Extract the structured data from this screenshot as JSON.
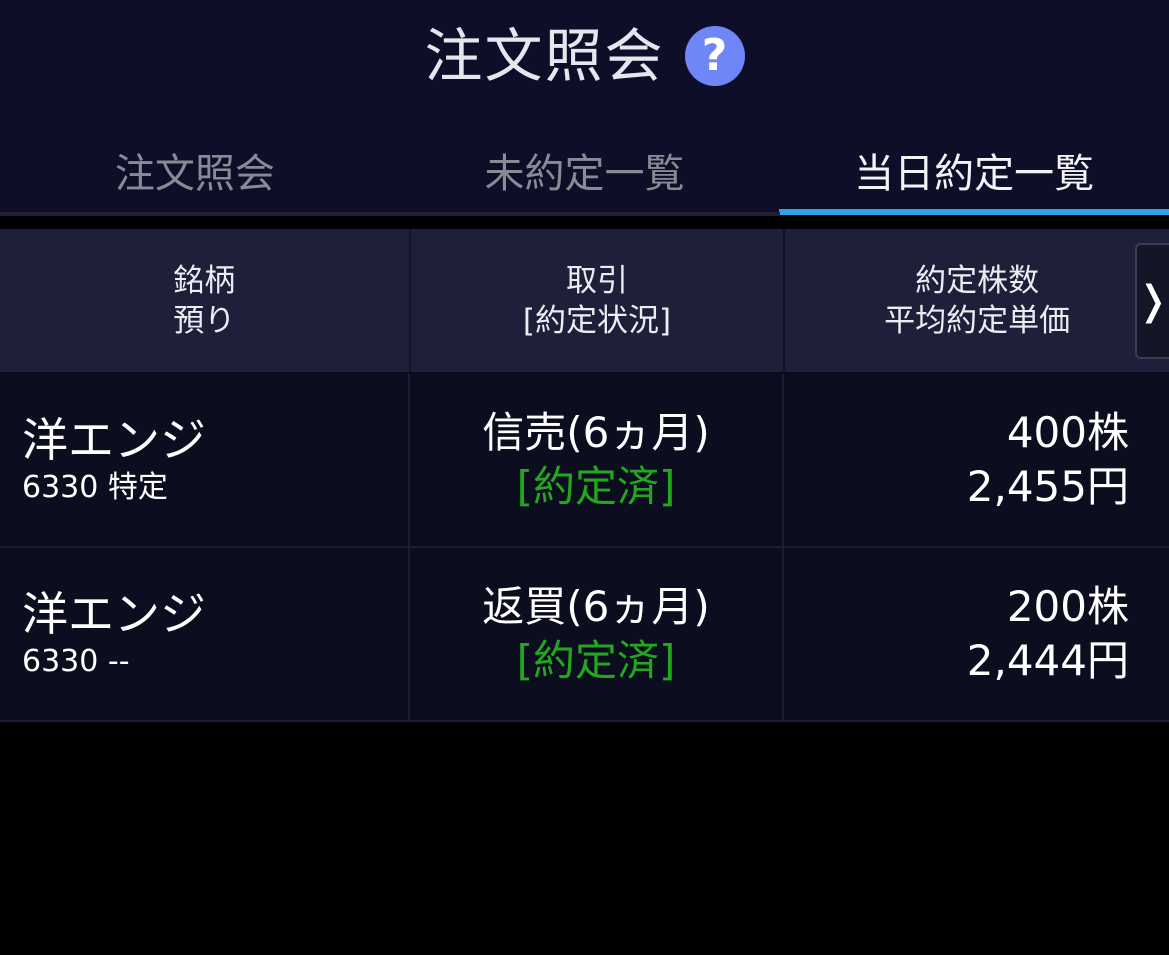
{
  "header": {
    "title": "注文照会",
    "help_icon": "?"
  },
  "tabs": [
    {
      "label": "注文照会",
      "active": false
    },
    {
      "label": "未約定一覧",
      "active": false
    },
    {
      "label": "当日約定一覧",
      "active": true
    }
  ],
  "table": {
    "headers": {
      "col1_line1": "銘柄",
      "col1_line2": "預り",
      "col2_line1": "取引",
      "col2_line2": "[約定状況]",
      "col3_line1": "約定株数",
      "col3_line2": "平均約定単価"
    },
    "scroll_arrow": "❭",
    "rows": [
      {
        "name": "洋エンジ",
        "code_account": "6330 特定",
        "trade_type": "信売(6ヵ月)",
        "status": "[約定済]",
        "quantity": "400株",
        "price": "2,455円"
      },
      {
        "name": "洋エンジ",
        "code_account": "6330 --",
        "trade_type": "返買(6ヵ月)",
        "status": "[約定済]",
        "quantity": "200株",
        "price": "2,444円"
      }
    ]
  },
  "colors": {
    "header_bg": "#0e0e28",
    "table_header_bg": "#1e203a",
    "row_bg": "#0c0d1f",
    "tab_indicator": "#2aa4e6",
    "status_green": "#22a81e",
    "help_icon_bg": "#6f86f7"
  }
}
